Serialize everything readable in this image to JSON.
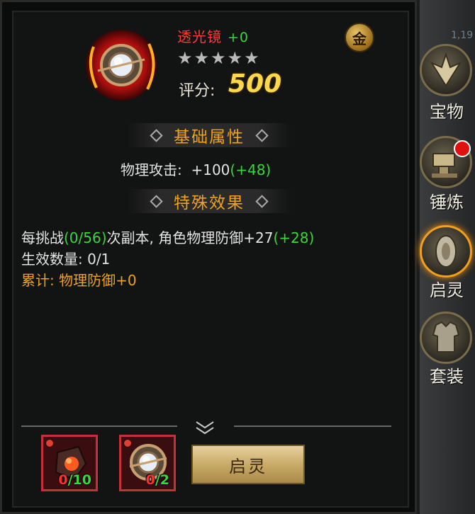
{
  "item": {
    "name": "透光镜",
    "enhance": "+0",
    "stars": "★★★★★",
    "score_label": "评分:",
    "score_value": "500",
    "badge": "金"
  },
  "basic": {
    "title": "基础属性",
    "attr_label": "物理攻击:",
    "attr_value": "+100",
    "attr_bonus": "(+48)"
  },
  "special": {
    "title": "特殊效果",
    "line1_a": "每挑战",
    "line1_progress": "(0/56)",
    "line1_b": "次副本, 角色物理防御+27",
    "line1_bonus": "(+28)",
    "line2": "生效数量: 0/1",
    "line3": "累计: 物理防御+0"
  },
  "materials": [
    {
      "have": "0",
      "need": "/10"
    },
    {
      "have": "0",
      "need": "/2"
    }
  ],
  "action_button": "启灵",
  "sidebar": {
    "corner_text": "1,19",
    "items": [
      {
        "label": "宝物",
        "icon": "treasure-icon"
      },
      {
        "label": "锤炼",
        "icon": "anvil-icon"
      },
      {
        "label": "启灵",
        "icon": "spirit-icon"
      },
      {
        "label": "套装",
        "icon": "armor-icon"
      }
    ]
  },
  "colors": {
    "name_red": "#ff3b3b",
    "bonus_green": "#3bd63b",
    "section_orange": "#f0a21e",
    "score_gold": "#ffd84a"
  }
}
